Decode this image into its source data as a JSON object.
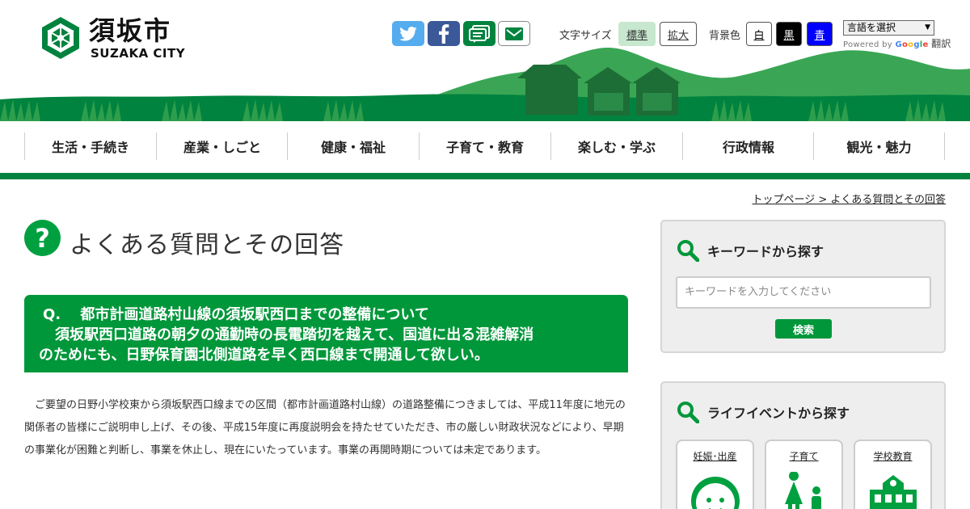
{
  "header": {
    "logo_name": "須坂市",
    "logo_sub": "SUZAKA CITY",
    "font_size_label": "文字サイズ",
    "font_size_normal": "標準",
    "font_size_large": "拡大",
    "bg_color_label": "背景色",
    "bg_white": "白",
    "bg_black": "黒",
    "bg_blue": "青",
    "language_select": "言語を選択",
    "powered_by": "Powered by",
    "google": [
      "G",
      "o",
      "o",
      "g",
      "l",
      "e"
    ],
    "translate": "翻訳"
  },
  "nav": {
    "items": [
      {
        "label": "生活・手続き"
      },
      {
        "label": "産業・しごと"
      },
      {
        "label": "健康・福祉"
      },
      {
        "label": "子育て・教育"
      },
      {
        "label": "楽しむ・学ぶ"
      },
      {
        "label": "行政情報"
      },
      {
        "label": "観光・魅力"
      }
    ]
  },
  "breadcrumb": "トップページ > よくある質問とその回答",
  "page_title": "よくある質問とその回答",
  "question": {
    "line1": "Q.　 都市計画道路村山線の須坂駅西口までの整備について",
    "line2": "須坂駅西口道路の朝夕の通勤時の長電踏切を越えて、国道に出る混雑解消",
    "line3": "のためにも、日野保育園北側道路を早く西口線まで開通して欲しい。"
  },
  "answer": "ご要望の日野小学校東から須坂駅西口線までの区間（都市計画道路村山線）の道路整備につきましては、平成11年度に地元の関係者の皆様にご説明申し上げ、その後、平成15年度に再度説明会を持たせていただき、市の厳しい財政状況などにより、早期の事業化が困難と判断し、事業を休止し、現在にいたっています。事業の再開時期については未定であります。",
  "sidebar": {
    "keyword_title": "キーワードから探す",
    "keyword_placeholder": "キーワードを入力してください",
    "keyword_search": "検索",
    "life_title": "ライフイベントから探す",
    "life_items": [
      {
        "label": "妊娠･出産"
      },
      {
        "label": "子育て"
      },
      {
        "label": "学校教育"
      }
    ]
  },
  "colors": {
    "brand_green": "#00833f",
    "question_green": "#00973a",
    "mountain_green": "#3aa655"
  },
  "icons": [
    "logo-mark",
    "twitter-icon",
    "facebook-icon",
    "line-icon",
    "mail-icon",
    "question-icon",
    "search-icon",
    "baby-icon",
    "parent-child-icon",
    "school-icon"
  ]
}
